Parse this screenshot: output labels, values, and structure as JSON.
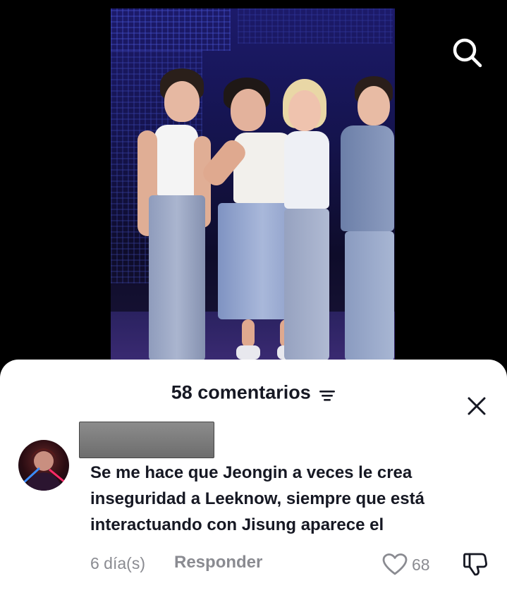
{
  "video": {
    "description_icon": "stage-performance-video",
    "search_icon": "search-icon"
  },
  "comments_panel": {
    "count_label": "58 comentarios",
    "filter_icon": "filter-icon",
    "close_icon": "close-icon"
  },
  "comment": {
    "avatar_icon": "avatar",
    "username_redacted": true,
    "text": "Se me hace que Jeongin a veces le crea inseguridad a Leeknow, siempre que está interactuando con Jisung aparece el",
    "date": "6 día(s)",
    "reply_label": "Responder",
    "like_count": "68",
    "like_icon": "heart-icon",
    "dislike_icon": "dislike-icon"
  },
  "colors": {
    "background": "#000000",
    "sheet": "#ffffff",
    "primary_text": "#161823",
    "secondary_text": "#8a8b91"
  }
}
